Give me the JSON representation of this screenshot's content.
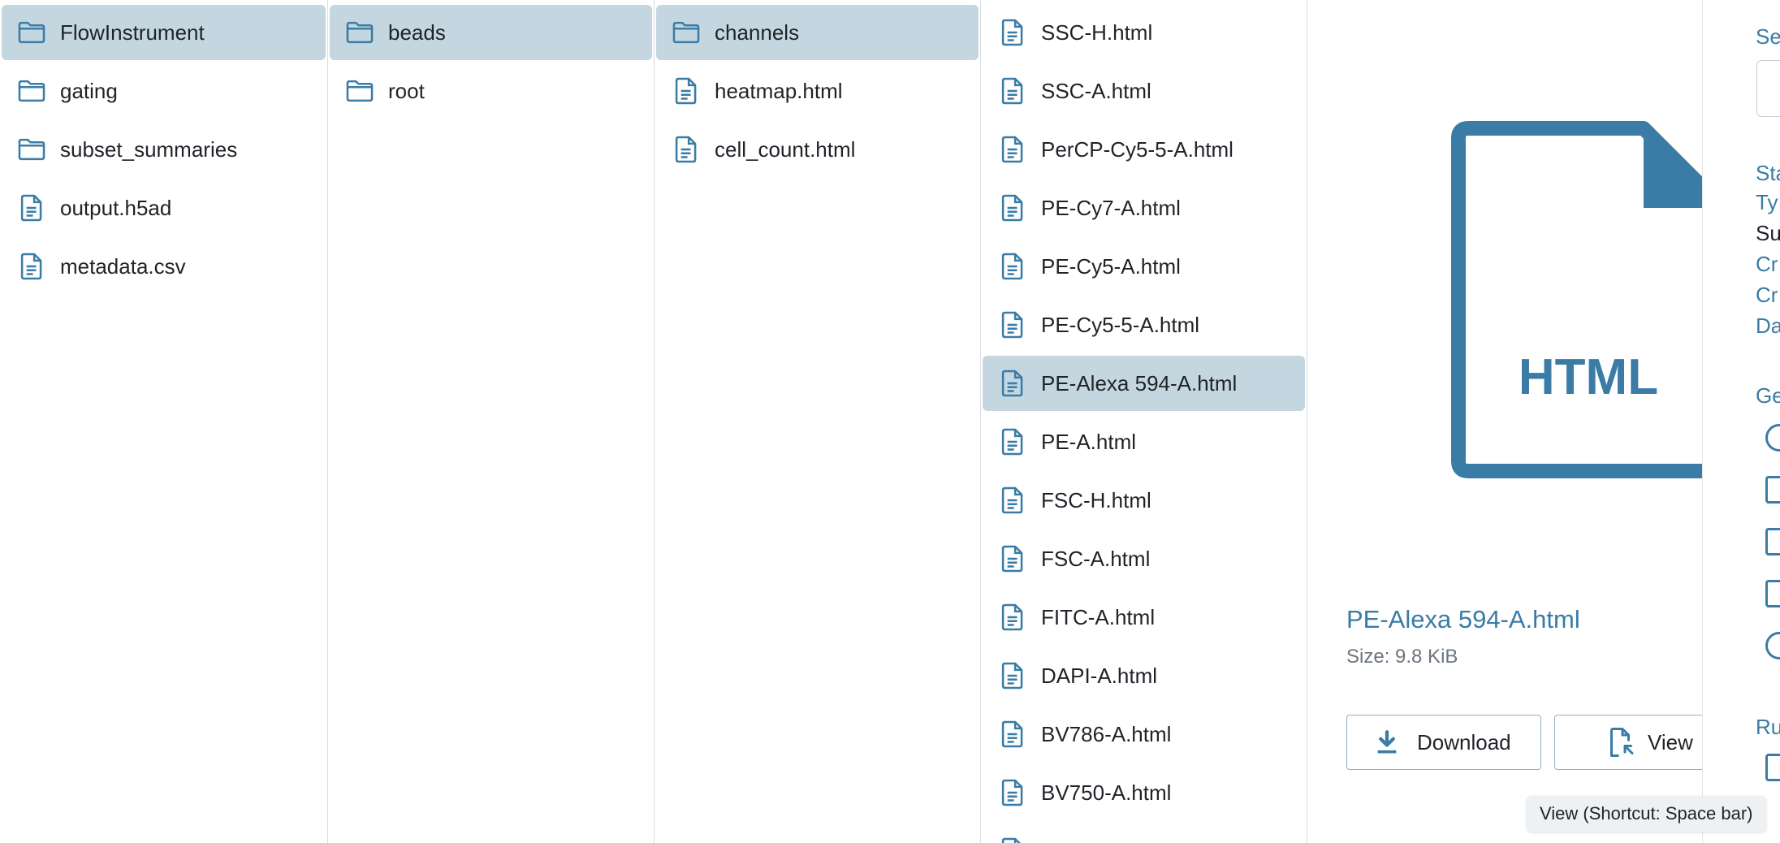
{
  "accent_color": "#3a7ca5",
  "selected_color": "#c4d7e0",
  "columns": [
    {
      "items": [
        {
          "label": "FlowInstrument",
          "icon": "folder-icon",
          "selected": true
        },
        {
          "label": "gating",
          "icon": "folder-icon",
          "selected": false
        },
        {
          "label": "subset_summaries",
          "icon": "folder-icon",
          "selected": false
        },
        {
          "label": "output.h5ad",
          "icon": "file-icon",
          "selected": false
        },
        {
          "label": "metadata.csv",
          "icon": "file-icon",
          "selected": false
        }
      ]
    },
    {
      "items": [
        {
          "label": "beads",
          "icon": "folder-icon",
          "selected": true
        },
        {
          "label": "root",
          "icon": "folder-icon",
          "selected": false
        }
      ]
    },
    {
      "items": [
        {
          "label": "channels",
          "icon": "folder-icon",
          "selected": true
        },
        {
          "label": "heatmap.html",
          "icon": "file-icon",
          "selected": false
        },
        {
          "label": "cell_count.html",
          "icon": "file-icon",
          "selected": false
        }
      ]
    },
    {
      "items": [
        {
          "label": "SSC-H.html",
          "icon": "file-icon",
          "selected": false
        },
        {
          "label": "SSC-A.html",
          "icon": "file-icon",
          "selected": false
        },
        {
          "label": "PerCP-Cy5-5-A.html",
          "icon": "file-icon",
          "selected": false
        },
        {
          "label": "PE-Cy7-A.html",
          "icon": "file-icon",
          "selected": false
        },
        {
          "label": "PE-Cy5-A.html",
          "icon": "file-icon",
          "selected": false
        },
        {
          "label": "PE-Cy5-5-A.html",
          "icon": "file-icon",
          "selected": false
        },
        {
          "label": "PE-Alexa 594-A.html",
          "icon": "file-icon",
          "selected": true
        },
        {
          "label": "PE-A.html",
          "icon": "file-icon",
          "selected": false
        },
        {
          "label": "FSC-H.html",
          "icon": "file-icon",
          "selected": false
        },
        {
          "label": "FSC-A.html",
          "icon": "file-icon",
          "selected": false
        },
        {
          "label": "FITC-A.html",
          "icon": "file-icon",
          "selected": false
        },
        {
          "label": "DAPI-A.html",
          "icon": "file-icon",
          "selected": false
        },
        {
          "label": "BV786-A.html",
          "icon": "file-icon",
          "selected": false
        },
        {
          "label": "BV750-A.html",
          "icon": "file-icon",
          "selected": false
        },
        {
          "label": "",
          "icon": "file-icon",
          "selected": false
        }
      ]
    }
  ],
  "preview": {
    "file_type_badge": "HTML",
    "file_name": "PE-Alexa 594-A.html",
    "size_text": "Size: 9.8 KiB",
    "download_label": "Download",
    "view_label": "View",
    "tooltip": "View (Shortcut: Space bar)"
  },
  "details": {
    "labels": [
      {
        "text": "Se",
        "color": "#3a7ca5"
      },
      {
        "text": "Sta",
        "color": "#3a7ca5"
      },
      {
        "text": "Ty",
        "color": "#3a7ca5"
      },
      {
        "text": "Su",
        "color": "#1f2328"
      },
      {
        "text": "Cr",
        "color": "#3a7ca5"
      },
      {
        "text": "Cr",
        "color": "#3a7ca5"
      },
      {
        "text": "Da",
        "color": "#3a7ca5"
      },
      {
        "text": "Ge",
        "color": "#3a7ca5"
      },
      {
        "text": "Ru",
        "color": "#3a7ca5"
      }
    ],
    "icons": [
      "database-icon",
      "chip-icon",
      "sliders-icon",
      "list-icon",
      "info-icon",
      "chip-icon"
    ]
  }
}
